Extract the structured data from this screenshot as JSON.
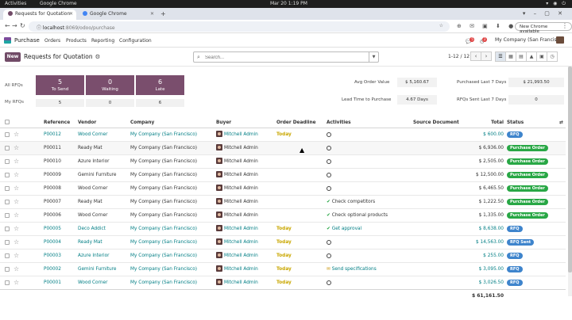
{
  "os": {
    "activities": "Activities",
    "app": "Google Chrome",
    "clock": "Mar 20  1:19 PM"
  },
  "browser": {
    "tabs": [
      {
        "title": "Requests for Quotation",
        "color": "#714b67"
      },
      {
        "title": "Google Chrome",
        "color": "#4285f4"
      }
    ],
    "url_host": "localhost",
    "url_path": ":8069/odoo/purchase",
    "update_label": "New Chrome available"
  },
  "odoo_nav": {
    "app_name": "Purchase",
    "menus": [
      "Orders",
      "Products",
      "Reporting",
      "Configuration"
    ],
    "chat_badge": "5",
    "activity_badge": "2",
    "company": "My Company (San Francisco)"
  },
  "control": {
    "new_label": "New",
    "title": "Requests for Quotation",
    "search_placeholder": "Search...",
    "pager": "1-12 / 12"
  },
  "dashboard": {
    "all_label": "All RFQs",
    "my_label": "My RFQs",
    "cards": [
      {
        "num": "5",
        "cap": "To Send",
        "mine": "5"
      },
      {
        "num": "0",
        "cap": "Waiting",
        "mine": "0"
      },
      {
        "num": "6",
        "cap": "Late",
        "mine": "6"
      }
    ],
    "stats": [
      {
        "label": "Avg Order Value",
        "value": "$ 5,160.67"
      },
      {
        "label": "Purchased Last 7 Days",
        "value": "$ 21,993.50"
      },
      {
        "label": "Lead Time to Purchase",
        "value": "4.67 Days"
      },
      {
        "label": "RFQs Sent Last 7 Days",
        "value": "0"
      }
    ]
  },
  "table": {
    "headers": [
      "Reference",
      "Vendor",
      "Company",
      "Buyer",
      "Order Deadline",
      "Activities",
      "Source Document",
      "Total",
      "Status"
    ],
    "rows": [
      {
        "ref": "P00012",
        "vendor": "Wood Corner",
        "company": "My Company (San Francisco)",
        "buyer": "Mitchell Admin",
        "deadline": "Today",
        "activity": "",
        "act_icon": "clock",
        "total": "$ 600.00",
        "status": "RFQ",
        "st": "rfq",
        "link": true
      },
      {
        "ref": "P00011",
        "vendor": "Ready Mat",
        "company": "My Company (San Francisco)",
        "buyer": "Mitchell Admin",
        "deadline": "",
        "activity": "",
        "act_icon": "clock",
        "total": "$ 6,936.00",
        "status": "Purchase Order",
        "st": "po",
        "link": false
      },
      {
        "ref": "P00010",
        "vendor": "Azure Interior",
        "company": "My Company (San Francisco)",
        "buyer": "Mitchell Admin",
        "deadline": "",
        "activity": "",
        "act_icon": "clock",
        "total": "$ 2,505.00",
        "status": "Purchase Order",
        "st": "po",
        "link": false
      },
      {
        "ref": "P00009",
        "vendor": "Gemini Furniture",
        "company": "My Company (San Francisco)",
        "buyer": "Mitchell Admin",
        "deadline": "",
        "activity": "",
        "act_icon": "clock",
        "total": "$ 12,500.00",
        "status": "Purchase Order",
        "st": "po",
        "link": false
      },
      {
        "ref": "P00008",
        "vendor": "Wood Corner",
        "company": "My Company (San Francisco)",
        "buyer": "Mitchell Admin",
        "deadline": "",
        "activity": "",
        "act_icon": "clock",
        "total": "$ 6,465.50",
        "status": "Purchase Order",
        "st": "po",
        "link": false
      },
      {
        "ref": "P00007",
        "vendor": "Ready Mat",
        "company": "My Company (San Francisco)",
        "buyer": "Mitchell Admin",
        "deadline": "",
        "activity": "Check competitors",
        "act_icon": "check",
        "total": "$ 1,222.50",
        "status": "Purchase Order",
        "st": "po",
        "link": false
      },
      {
        "ref": "P00006",
        "vendor": "Wood Corner",
        "company": "My Company (San Francisco)",
        "buyer": "Mitchell Admin",
        "deadline": "",
        "activity": "Check optional products",
        "act_icon": "check",
        "total": "$ 1,335.00",
        "status": "Purchase Order",
        "st": "po",
        "link": false
      },
      {
        "ref": "P00005",
        "vendor": "Deco Addict",
        "company": "My Company (San Francisco)",
        "buyer": "Mitchell Admin",
        "deadline": "Today",
        "activity": "Get approval",
        "act_icon": "check",
        "total": "$ 8,638.00",
        "status": "RFQ",
        "st": "rfq",
        "link": true
      },
      {
        "ref": "P00004",
        "vendor": "Ready Mat",
        "company": "My Company (San Francisco)",
        "buyer": "Mitchell Admin",
        "deadline": "Today",
        "activity": "",
        "act_icon": "clock",
        "total": "$ 14,563.00",
        "status": "RFQ Sent",
        "st": "sent",
        "link": true
      },
      {
        "ref": "P00003",
        "vendor": "Azure Interior",
        "company": "My Company (San Francisco)",
        "buyer": "Mitchell Admin",
        "deadline": "Today",
        "activity": "",
        "act_icon": "clock",
        "total": "$ 255.00",
        "status": "RFQ",
        "st": "rfq",
        "link": true
      },
      {
        "ref": "P00002",
        "vendor": "Gemini Furniture",
        "company": "My Company (San Francisco)",
        "buyer": "Mitchell Admin",
        "deadline": "Today",
        "activity": "Send specifications",
        "act_icon": "mail",
        "total": "$ 3,095.00",
        "status": "RFQ",
        "st": "rfq",
        "link": true
      },
      {
        "ref": "P00001",
        "vendor": "Wood Corner",
        "company": "My Company (San Francisco)",
        "buyer": "Mitchell Admin",
        "deadline": "Today",
        "activity": "",
        "act_icon": "clock",
        "total": "$ 3,026.50",
        "status": "RFQ",
        "st": "rfq",
        "link": true
      }
    ],
    "grand_total": "$ 61,161.50"
  }
}
